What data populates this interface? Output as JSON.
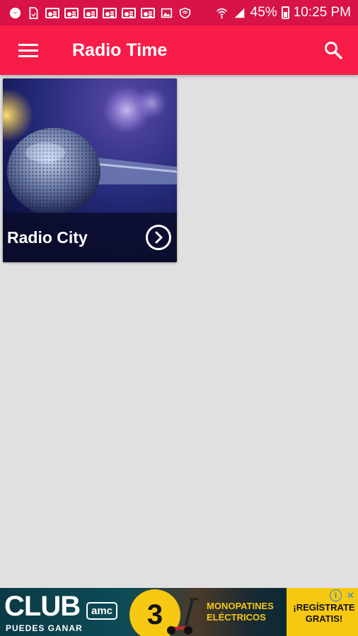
{
  "status_bar": {
    "battery": "45%",
    "time": "10:25 PM",
    "bg_color": "#d81348"
  },
  "app_bar": {
    "title": "Radio Time",
    "menu_icon": "hamburger-menu-icon",
    "search_icon": "search-icon",
    "bg_color": "#f81c48"
  },
  "stations": [
    {
      "name": "Radio City",
      "image": "microphone-image",
      "action_icon": "chevron-right-circle-icon"
    }
  ],
  "ad": {
    "club": "CLUB",
    "sub": "PUEDES GANAR",
    "brand": "amc",
    "number": "3",
    "prize_line1": "MONOPATINES",
    "prize_line2": "ELÉCTRICOS",
    "cta_line1": "¡REGÍSTRATE",
    "cta_line2": "GRATIS!"
  }
}
